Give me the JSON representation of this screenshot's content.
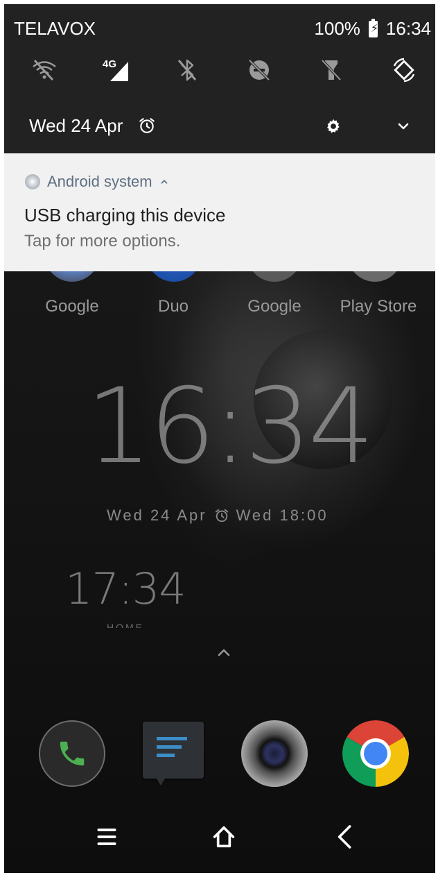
{
  "status_bar": {
    "carrier": "TELAVOX",
    "battery": "100%",
    "time": "16:34"
  },
  "quick_settings": {
    "tiles": [
      "wifi-off-icon",
      "mobile-data-4g-icon",
      "bluetooth-off-icon",
      "dnd-off-icon",
      "flashlight-off-icon",
      "auto-rotate-icon"
    ],
    "network_label": "4G",
    "date": "Wed 24 Apr"
  },
  "notification": {
    "app": "Android system",
    "title": "USB charging this device",
    "subtitle": "Tap for more options."
  },
  "home_apps": [
    {
      "label": "Google"
    },
    {
      "label": "Duo"
    },
    {
      "label": "Google"
    },
    {
      "label": "Play Store"
    }
  ],
  "lock_clock": {
    "time": "16:34",
    "date": "Wed 24 Apr",
    "alarm": "Wed 18:00"
  },
  "home_clock": {
    "time": "17:34",
    "label": "HOME"
  },
  "dock": [
    "phone-icon",
    "messages-icon",
    "camera-icon",
    "chrome-icon"
  ],
  "colors": {
    "quick_settings_bg": "#222222",
    "notification_bg": "#f1f1f1",
    "notification_app_color": "#5e6f82",
    "phone_green": "#4caf50",
    "messages_blue": "#3c8dc8"
  }
}
